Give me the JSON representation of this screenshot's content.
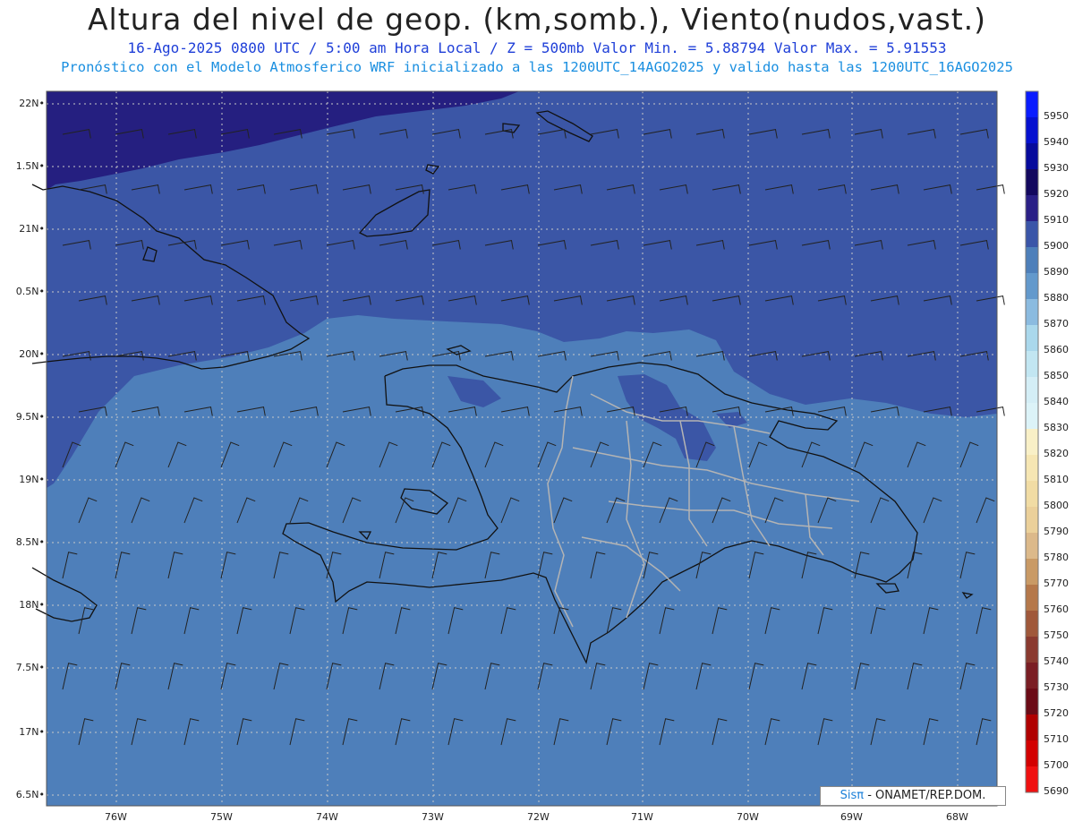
{
  "header": {
    "title": "Altura del nivel de geop. (km,somb.), Viento(nudos,vast.)",
    "subtitle": "16-Ago-2025  0800 UTC / 5:00 am Hora Local / Z = 500mb    Valor Min. = 5.88794  Valor Max. = 5.91553",
    "model_line": "Pronóstico con el Modelo Atmosferico WRF inicializado a las 1200UTC_14AGO2025 y valido hasta las  1200UTC_16AGO2025"
  },
  "credit": {
    "brand": "Sisπ",
    "text": " - ONAMET/REP.DOM."
  },
  "axes": {
    "lat_labels": [
      "22N",
      "1.5N",
      "21N",
      "0.5N",
      "20N",
      "9.5N",
      "19N",
      "8.5N",
      "18N",
      "7.5N",
      "17N",
      "6.5N"
    ],
    "lon_labels": [
      "76W",
      "75W",
      "74W",
      "73W",
      "72W",
      "71W",
      "70W",
      "69W",
      "68W"
    ]
  },
  "colorbar": {
    "levels": [
      "5950",
      "5940",
      "5930",
      "5920",
      "5910",
      "5900",
      "5890",
      "5880",
      "5870",
      "5860",
      "5850",
      "5840",
      "5830",
      "5820",
      "5810",
      "5800",
      "5790",
      "5780",
      "5770",
      "5760",
      "5750",
      "5740",
      "5730",
      "5720",
      "5710",
      "5700",
      "5690"
    ],
    "colors": [
      "#0a1cff",
      "#0510d0",
      "#060a9c",
      "#13085e",
      "#2a1f86",
      "#3a55a8",
      "#4d7fba",
      "#6399cc",
      "#8bbbe0",
      "#aad8ec",
      "#c2e6f2",
      "#d4eef6",
      "#dcf3f8",
      "#f9f0c7",
      "#f6e6b3",
      "#f1dca4",
      "#ebd09a",
      "#dcb98a",
      "#c99a65",
      "#b5784a",
      "#a0583a",
      "#8a3a2f",
      "#7a1e24",
      "#6b0b16",
      "#b00000",
      "#d30000",
      "#f01010"
    ],
    "background_color": "#4e7fba",
    "high_contour_color": "#3b56a6",
    "highest_contour_color": "#251f80"
  }
}
